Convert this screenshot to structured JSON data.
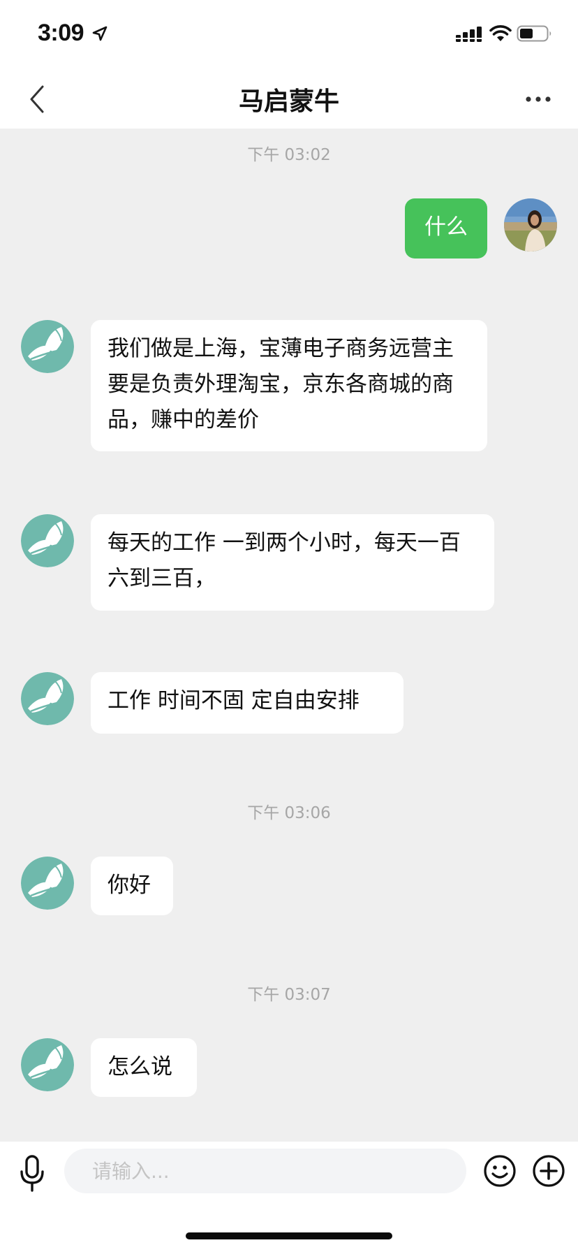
{
  "status_bar": {
    "time": "3:09"
  },
  "header": {
    "title": "马启蒙牛"
  },
  "messages": [
    {
      "type": "timestamp",
      "text": "下午 03:02"
    },
    {
      "type": "sent",
      "text": "什么"
    },
    {
      "type": "received",
      "text": "我们做是上海，宝薄电子商务远营主要是负责外理淘宝，京东各商城的商品，赚中的差价"
    },
    {
      "type": "received",
      "text": "每天的工作 一到两个小时，每天一百六到三百，"
    },
    {
      "type": "received",
      "text": "工作 时间不固 定自由安排"
    },
    {
      "type": "timestamp",
      "text": "下午 03:06"
    },
    {
      "type": "received",
      "text": "你好"
    },
    {
      "type": "timestamp",
      "text": "下午 03:07"
    },
    {
      "type": "received",
      "text": "怎么说"
    }
  ],
  "input": {
    "placeholder": "请输入..."
  },
  "icons": {
    "back": "chevron-left-icon",
    "more": "more-dots-icon",
    "mic": "microphone-icon",
    "emoji": "emoji-icon",
    "plus": "plus-circle-icon"
  },
  "colors": {
    "sent_bubble": "#46c25a",
    "received_bubble": "#ffffff",
    "chat_background": "#efefef",
    "timestamp_text": "#a6a6a6",
    "contact_avatar": "#6fb9ac"
  }
}
